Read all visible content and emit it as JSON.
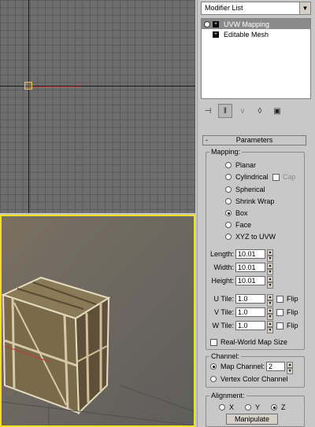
{
  "modifier_list": {
    "label": "Modifier List"
  },
  "stack": {
    "items": [
      {
        "label": "UVW Mapping",
        "selected": true
      },
      {
        "label": "Editable Mesh",
        "selected": false
      }
    ]
  },
  "stack_tools": [
    "pin-stack-icon",
    "show-end-result-icon",
    "make-unique-icon",
    "remove-modifier-icon",
    "configure-modifier-sets-icon"
  ],
  "rollout": {
    "title": "Parameters",
    "collapse": "-"
  },
  "mapping": {
    "title": "Mapping:",
    "options": [
      "Planar",
      "Cylindrical",
      "Spherical",
      "Shrink Wrap",
      "Box",
      "Face",
      "XYZ to UVW"
    ],
    "selected": "Box",
    "cap_label": "Cap",
    "length_label": "Length:",
    "length": "10.01",
    "width_label": "Width:",
    "width": "10.01",
    "height_label": "Height:",
    "height": "10.01",
    "utile_label": "U Tile:",
    "utile": "1.0",
    "vtile_label": "V Tile:",
    "vtile": "1.0",
    "wtile_label": "W Tile:",
    "wtile": "1.0",
    "flip_label": "Flip",
    "real_world_label": "Real-World Map Size"
  },
  "channel": {
    "title": "Channel:",
    "map_channel_label": "Map Channel:",
    "map_channel_value": "2",
    "vertex_color_label": "Vertex Color Channel",
    "selected": "map"
  },
  "alignment": {
    "title": "Alignment:",
    "x": "X",
    "y": "Y",
    "z": "Z",
    "selected": "Z",
    "manipulate_label": "Manipulate"
  },
  "colors": {
    "active_viewport_border": "#f2e01a",
    "viewport_bg": "#6e6e6e"
  }
}
